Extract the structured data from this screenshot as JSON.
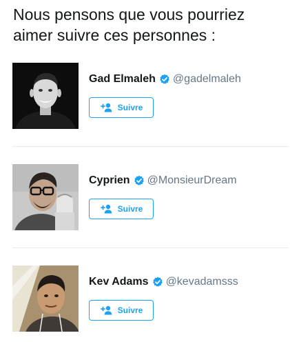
{
  "heading": "Nous pensons que vous pourriez aimer suivre ces personnes :",
  "colors": {
    "accent": "#1da1f2",
    "handle": "#657786",
    "divider": "#e6ecf0"
  },
  "suggestions": [
    {
      "name": "Gad Elmaleh",
      "verified": true,
      "handle": "@gadelmaleh",
      "follow_label": "Suivre",
      "avatar_icon": "portrait-photo"
    },
    {
      "name": "Cyprien",
      "verified": true,
      "handle": "@MonsieurDream",
      "follow_label": "Suivre",
      "avatar_icon": "portrait-photo"
    },
    {
      "name": "Kev Adams",
      "verified": true,
      "handle": "@kevadamsss",
      "follow_label": "Suivre",
      "avatar_icon": "portrait-photo"
    }
  ]
}
